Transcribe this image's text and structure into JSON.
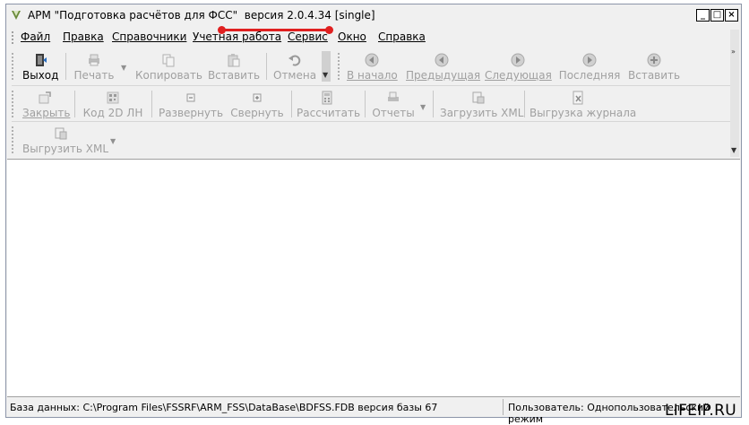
{
  "window": {
    "title": "АРМ \"Подготовка расчётов для ФСС\"  версия 2.0.4.34 [single]"
  },
  "menu": [
    "Файл",
    "Правка",
    "Справочники",
    "Учетная работа",
    "Сервис",
    "Окно",
    "Справка"
  ],
  "toolbar1": {
    "exit": "Выход",
    "print": "Печать",
    "copy": "Копировать",
    "paste": "Вставить",
    "undo": "Отмена",
    "first": "В начало",
    "prev": "Предыдущая",
    "next": "Следующая",
    "last": "Последняя",
    "insert": "Вставить"
  },
  "toolbar2": {
    "close": "Закрыть",
    "code2d": "Код 2D  ЛН",
    "expand": "Развернуть",
    "collapse": "Свернуть",
    "calculate": "Рассчитать",
    "reports": "Отчеты",
    "load_xml": "Загрузить XML",
    "export_log": "Выгрузка журнала"
  },
  "toolbar3": {
    "export_xml": "Выгрузить XML"
  },
  "status": {
    "database": "База данных: C:\\Program Files\\FSSRF\\ARM_FSS\\DataBase\\BDFSS.FDB   версия базы 67",
    "user": "Пользователь: Однопользовательский режим"
  },
  "watermark": "LIFEIP.RU",
  "colors": {
    "annotation": "#e02020",
    "disabled_text": "#a0a0a0"
  }
}
